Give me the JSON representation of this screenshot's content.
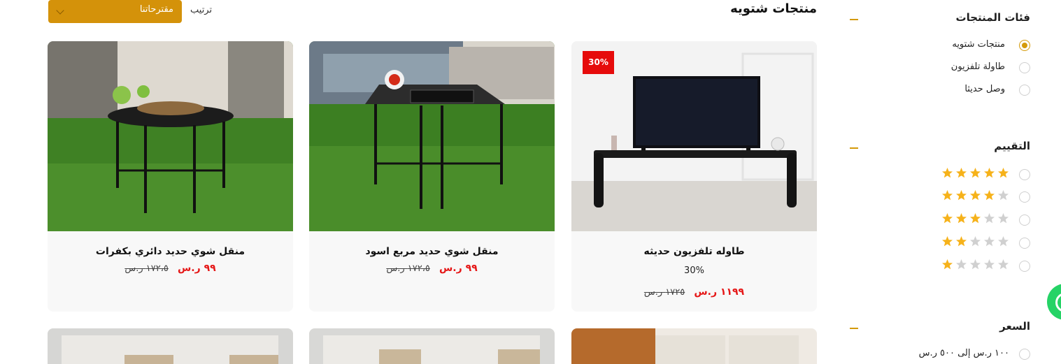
{
  "sidebar": {
    "categories": {
      "title": "فئات المنتجات",
      "options": [
        {
          "label": "منتجات شتويه",
          "checked": true
        },
        {
          "label": "طاولة تلفزيون",
          "checked": false
        },
        {
          "label": "وصل حديثا",
          "checked": false
        }
      ]
    },
    "rating": {
      "title": "التقييم",
      "options": [
        {
          "filled": 5,
          "total": 5
        },
        {
          "filled": 4,
          "total": 5
        },
        {
          "filled": 3,
          "total": 5
        },
        {
          "filled": 2,
          "total": 5
        },
        {
          "filled": 1,
          "total": 5
        }
      ]
    },
    "price": {
      "title": "السعر",
      "options": [
        {
          "label": "١٠٠ ر.س إلى ٥٠٠ ر.س",
          "checked": false
        }
      ]
    }
  },
  "main": {
    "title": "منتجات شتويه",
    "sort_label": "ترتيب",
    "sort_value": "مقترحاتنا"
  },
  "products": [
    {
      "name": "طاوله تلفزيون حديثه",
      "badge": "30%",
      "discount": "30%",
      "price": "١١٩٩ ر.س",
      "old_price": "١٧٢٥ ر.س"
    },
    {
      "name": "منقل شوي حديد مربع اسود",
      "badge": "",
      "discount": "",
      "price": "٩٩ ر.س",
      "old_price": "١٧٢،٥ ر.س"
    },
    {
      "name": "منقل شوي حديد دائري بكفرات",
      "badge": "",
      "discount": "",
      "price": "٩٩ ر.س",
      "old_price": "١٧٢،٥ ر.س"
    }
  ],
  "colors": {
    "accent": "#d4920a",
    "sale": "#e51616",
    "star": "#f6b21a",
    "star_empty": "#d0d0d0"
  }
}
